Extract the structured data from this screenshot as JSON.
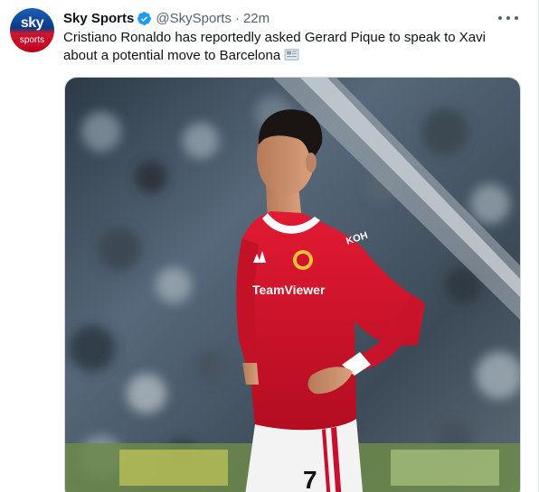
{
  "tweet": {
    "author_name": "Sky Sports",
    "handle": "@SkySports",
    "separator": "·",
    "time": "22m",
    "text": "Cristiano Ronaldo has reportedly asked Gerard Pique to speak to Xavi about a potential move to Barcelona"
  },
  "avatar": {
    "logo_top": "sky",
    "logo_bottom": "sports"
  },
  "photo": {
    "shirt_sponsor": "TeamViewer",
    "sleeve_sponsor": "KOH",
    "shirt_number": "7"
  },
  "colors": {
    "verified": "#1d9bf0",
    "shirt_red": "#d0102c",
    "link_gray": "#536471"
  },
  "icons": {
    "verified": "verified-badge-icon",
    "more": "more-dots-icon",
    "news": "newspaper-emoji-icon"
  }
}
